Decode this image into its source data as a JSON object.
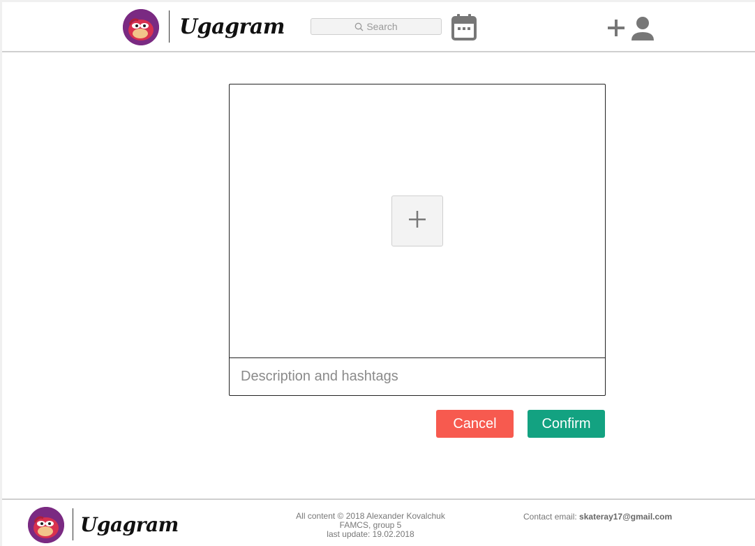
{
  "header": {
    "brand": "Ugagram",
    "search": {
      "placeholder": "Search"
    }
  },
  "upload": {
    "description_placeholder": "Description and hashtags"
  },
  "actions": {
    "cancel_label": "Cancel",
    "confirm_label": "Confirm"
  },
  "footer": {
    "brand": "Ugagram",
    "copyright": "All content © 2018 Alexander Kovalchuk",
    "group": "FAMCS, group 5",
    "last_update": "last update: 19.02.2018",
    "contact_label": "Contact email:",
    "contact_email": "skateray17@gmail.com"
  },
  "icons": {
    "logo": "ugandan-knuckles-logo",
    "search": "search-icon",
    "calendar": "calendar-icon",
    "add_user": "add-user-icon",
    "add_image": "plus-icon"
  },
  "colors": {
    "cancel": "#f75a4f",
    "confirm": "#13a281",
    "logo_bg": "#7a2a82",
    "icon_gray": "#777777"
  }
}
